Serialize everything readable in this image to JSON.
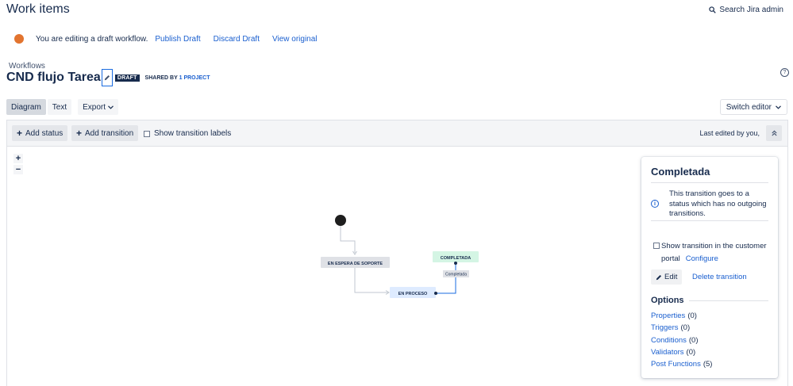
{
  "topbar": {
    "heading": "Work items",
    "search_label": "Search Jira admin"
  },
  "banner": {
    "message": "You are editing a draft workflow.",
    "publish": "Publish Draft",
    "discard": "Discard Draft",
    "view_original": "View original"
  },
  "header": {
    "breadcrumb": "Workflows",
    "title": "CND flujo Tarea",
    "badge": "DRAFT",
    "shared_prefix": "SHARED BY",
    "shared_link": "1 PROJECT"
  },
  "view_tabs": {
    "diagram": "Diagram",
    "text": "Text",
    "export": "Export",
    "switch_editor": "Switch editor"
  },
  "toolbar": {
    "add_status": "Add status",
    "add_transition": "Add transition",
    "show_labels": "Show transition labels",
    "last_edited": "Last edited by you,"
  },
  "zoom": {
    "in": "+",
    "out": "−"
  },
  "diagram": {
    "statuses": [
      {
        "name": "EN ESPERA DE SOPORTE",
        "color": "#dfe1e6"
      },
      {
        "name": "EN PROCESO",
        "color": "#deebff"
      },
      {
        "name": "COMPLETADA",
        "color": "#d4f5e4"
      }
    ],
    "transition_label": "Completada"
  },
  "panel": {
    "title": "Completada",
    "info": "This transition goes to a status which has no outgoing transitions.",
    "customer_portal": "Show transition in the customer portal",
    "configure": "Configure",
    "edit": "Edit",
    "delete": "Delete transition",
    "options_title": "Options",
    "options": [
      {
        "label": "Properties",
        "count": "(0)"
      },
      {
        "label": "Triggers",
        "count": "(0)"
      },
      {
        "label": "Conditions",
        "count": "(0)"
      },
      {
        "label": "Validators",
        "count": "(0)"
      },
      {
        "label": "Post Functions",
        "count": "(5)"
      }
    ]
  },
  "colors": {
    "link": "#1a5fcf",
    "draft_dot": "#e2742f",
    "transition_selected": "#1a6be0"
  }
}
